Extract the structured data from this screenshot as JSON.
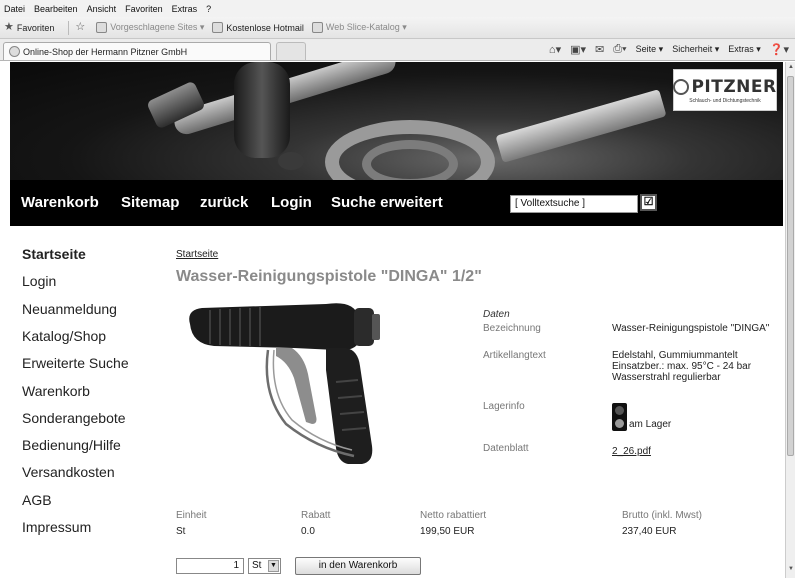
{
  "browser": {
    "menu": [
      "Datei",
      "Bearbeiten",
      "Ansicht",
      "Favoriten",
      "Extras",
      "?"
    ],
    "favorites_label": "Favoriten",
    "favorites_items": [
      "Vorgeschlagene Sites ▾",
      "Kostenlose Hotmail",
      "Web Slice-Katalog ▾"
    ],
    "tab_title": "Online-Shop der Hermann Pitzner GmbH",
    "commands": [
      "Seite ▾",
      "Sicherheit ▾",
      "Extras ▾"
    ]
  },
  "banner": {
    "logo_text": "PITZNER",
    "logo_subtitle": "Schlauch- und Dichtungstechnik"
  },
  "nav": {
    "links": [
      "Warenkorb",
      "Sitemap",
      "zurück",
      "Login",
      "Suche erweitert"
    ],
    "search_value": "[ Volltextsuche ]",
    "search_button": "☑"
  },
  "sidebar": {
    "items": [
      "Startseite",
      "Login",
      "Neuanmeldung",
      "Katalog/Shop",
      "Erweiterte Suche",
      "Warenkorb",
      "Sonderangebote",
      "Bedienung/Hilfe",
      "Versandkosten",
      "AGB",
      "Impressum"
    ]
  },
  "product": {
    "breadcrumb": "Startseite",
    "title": "Wasser-Reinigungspistole \"DINGA\" 1/2\"",
    "data_heading": "Daten",
    "labels": {
      "bezeichnung": "Bezeichnung",
      "artikellangtext": "Artikellangtext",
      "lagerinfo": "Lagerinfo",
      "datenblatt": "Datenblatt"
    },
    "values": {
      "bezeichnung": "Wasser-Reinigungspistole \"DINGA\"",
      "artikellangtext_1": "Edelstahl, Gummiummantelt",
      "artikellangtext_2": "Einsatzber.: max. 95°C - 24 bar",
      "artikellangtext_3": "Wasserstrahl regulierbar",
      "lagerinfo": "am Lager",
      "datenblatt": "2_26.pdf"
    }
  },
  "pricing": {
    "headers": [
      "Einheit",
      "Rabatt",
      "Netto rabattiert",
      "Brutto (inkl. Mwst)"
    ],
    "row": [
      "St",
      "0.0",
      "199,50 EUR",
      "237,40 EUR"
    ]
  },
  "order": {
    "quantity": "1",
    "unit": "St",
    "button": "in den Warenkorb"
  }
}
